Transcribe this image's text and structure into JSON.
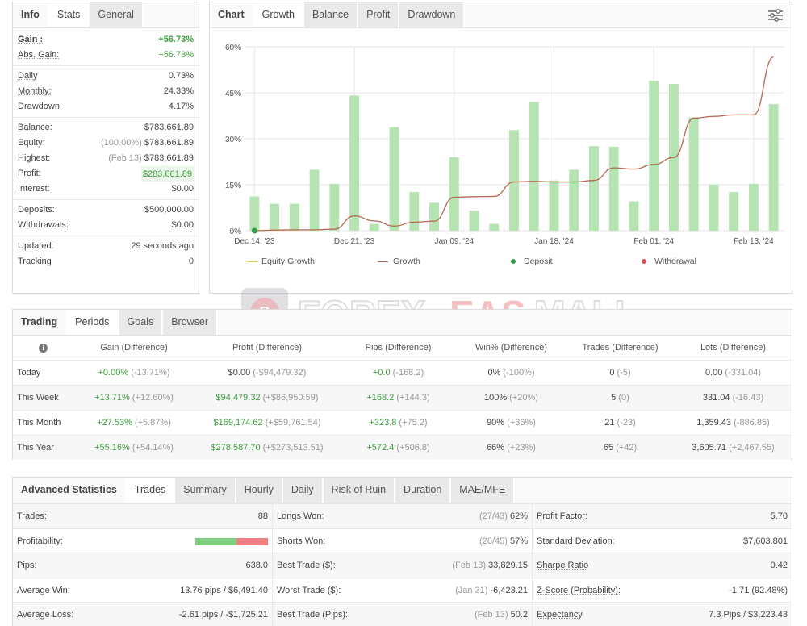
{
  "info": {
    "tabs": [
      "Info",
      "Stats",
      "General"
    ],
    "gain": {
      "label": "Gain :",
      "value": "+56.73%"
    },
    "abs_gain": {
      "label": "Abs. Gain:",
      "value": "+56.73%"
    },
    "daily": {
      "label": "Daily",
      "value": "0.73%"
    },
    "monthly": {
      "label": "Monthly:",
      "value": "24.33%"
    },
    "drawdown": {
      "label": "Drawdown:",
      "value": "4.17%"
    },
    "balance": {
      "label": "Balance:",
      "value": "$783,661.89"
    },
    "equity": {
      "label": "Equity:",
      "note": "(100.00%)",
      "value": "$783,661.89"
    },
    "highest": {
      "label": "Highest:",
      "note": "(Feb 13)",
      "value": "$783,661.89"
    },
    "profit": {
      "label": "Profit:",
      "value": "$283,661.89"
    },
    "interest": {
      "label": "Interest:",
      "value": "$0.00"
    },
    "deposits": {
      "label": "Deposits:",
      "value": "$500,000.00"
    },
    "withdrawals": {
      "label": "Withdrawals:",
      "value": "$0.00"
    },
    "updated": {
      "label": "Updated:",
      "value": "29 seconds ago"
    },
    "tracking": {
      "label": "Tracking",
      "value": "0"
    }
  },
  "chart_panel": {
    "tabs": [
      "Chart",
      "Growth",
      "Balance",
      "Profit",
      "Drawdown"
    ],
    "legend": [
      "Equity Growth",
      "Growth",
      "Deposit",
      "Withdrawal"
    ],
    "colors": {
      "bars": "#b5e3b1",
      "growth": "#b46a52",
      "equity": "#e8c66a",
      "deposit": "#2e9e46",
      "withdrawal": "#d9534f"
    }
  },
  "chart_data": {
    "type": "bar",
    "title": "",
    "xlabel": "",
    "ylabel": "",
    "ylim": [
      0,
      60
    ],
    "y_ticks": [
      "0%",
      "15%",
      "30%",
      "45%",
      "60%"
    ],
    "x_tick_labels": [
      "Dec 14, '23",
      "Dec 21, '23",
      "Jan 09, '24",
      "Jan 18, '24",
      "Feb 01, '24",
      "Feb 13, '24"
    ],
    "x_tick_positions": [
      0,
      5,
      10,
      15,
      20,
      25
    ],
    "series": [
      {
        "name": "",
        "type": "bar",
        "values": [
          11.2,
          8.8,
          8.8,
          19.9,
          15.3,
          44.1,
          2.2,
          33.8,
          12.6,
          9.1,
          24,
          6.6,
          2.2,
          32.8,
          42,
          16.4,
          19.9,
          27.6,
          27.4,
          9.6,
          48.9,
          47.9,
          37,
          15.1,
          12.6,
          15.3,
          41.3
        ]
      },
      {
        "name": "Growth",
        "type": "line",
        "values": [
          0,
          0.2,
          0.3,
          0.3,
          0.5,
          4.8,
          3.2,
          1.5,
          2.8,
          3.1,
          10.9,
          11.1,
          11.2,
          15.9,
          16.1,
          15.9,
          15.9,
          16.4,
          20.5,
          20.1,
          21.6,
          23.9,
          36.7,
          37.3,
          37.8,
          37.8,
          56.7
        ]
      },
      {
        "name": "Deposit",
        "type": "point",
        "x": [
          0
        ],
        "values": [
          0
        ]
      }
    ]
  },
  "watermark": {
    "part1": "FOREX",
    "part2": "EAS",
    "part3": "MALL"
  },
  "periods": {
    "tabs": [
      "Trading",
      "Periods",
      "Goals",
      "Browser"
    ],
    "info_icon": "info-icon",
    "headers": [
      "Gain (Difference)",
      "Profit (Difference)",
      "Pips (Difference)",
      "Win% (Difference)",
      "Trades (Difference)",
      "Lots (Difference)"
    ],
    "rows": [
      {
        "label": "Today",
        "gain": "+0.00%",
        "gain_diff": "(-13.71%)",
        "profit": "$0.00",
        "profit_diff": "(-$94,479.32)",
        "pips": "+0.0",
        "pips_diff": "(-168.2)",
        "win": "0%",
        "win_diff": "(-100%)",
        "trades": "0",
        "trades_diff": "(-5)",
        "lots": "0.00",
        "lots_diff": "(-331.04)"
      },
      {
        "label": "This Week",
        "gain": "+13.71%",
        "gain_diff": "(+12.60%)",
        "profit": "$94,479.32",
        "profit_diff": "(+$86,950.59)",
        "pips": "+168.2",
        "pips_diff": "(+144.3)",
        "win": "100%",
        "win_diff": "(+20%)",
        "trades": "5",
        "trades_diff": "(0)",
        "lots": "331.04",
        "lots_diff": "(-16.43)"
      },
      {
        "label": "This Month",
        "gain": "+27.53%",
        "gain_diff": "(+5.87%)",
        "profit": "$169,174.62",
        "profit_diff": "(+$59,761.54)",
        "pips": "+323.8",
        "pips_diff": "(+75.2)",
        "win": "90%",
        "win_diff": "(+36%)",
        "trades": "21",
        "trades_diff": "(-23)",
        "lots": "1,359.43",
        "lots_diff": "(-886.85)"
      },
      {
        "label": "This Year",
        "gain": "+55.16%",
        "gain_diff": "(+54.14%)",
        "profit": "$278,587.70",
        "profit_diff": "(+$273,513.51)",
        "pips": "+572.4",
        "pips_diff": "(+506.8)",
        "win": "66%",
        "win_diff": "(+23%)",
        "trades": "65",
        "trades_diff": "(+42)",
        "lots": "3,605.71",
        "lots_diff": "(+2,467.55)"
      }
    ]
  },
  "advanced": {
    "tabs": [
      "Advanced Statistics",
      "Trades",
      "Summary",
      "Hourly",
      "Daily",
      "Risk of Ruin",
      "Duration",
      "MAE/MFE"
    ],
    "col1": [
      {
        "label": "Trades:",
        "value": "88"
      },
      {
        "label": "Profitability:",
        "bar_win_fraction": 0.57
      },
      {
        "label": "Pips:",
        "value": "638.0"
      },
      {
        "label": "Average Win:",
        "value": "13.76 pips / $6,491.40"
      },
      {
        "label": "Average Loss:",
        "value": "-2.61 pips / -$1,725.21"
      }
    ],
    "col2": [
      {
        "label": "Longs Won:",
        "note": "(27/43)",
        "value": "62%"
      },
      {
        "label": "Shorts Won:",
        "note": "(26/45)",
        "value": "57%"
      },
      {
        "label": "Best Trade ($):",
        "note": "(Feb 13)",
        "value": "33,829.15"
      },
      {
        "label": "Worst Trade ($):",
        "note": "(Jan 31)",
        "value": "-6,423.21"
      },
      {
        "label": "Best Trade (Pips):",
        "note": "(Feb 13)",
        "value": "50.2"
      }
    ],
    "col3": [
      {
        "label": "Profit Factor:",
        "value": "5.70"
      },
      {
        "label": "Standard Deviation:",
        "value": "$7,603.801"
      },
      {
        "label": "Sharpe Ratio",
        "value": "0.42"
      },
      {
        "label": "Z-Score (Probability):",
        "value": "-1.71 (92.48%)"
      },
      {
        "label": "Expectancy",
        "value": "7.3 Pips / $3,223.43"
      }
    ]
  }
}
